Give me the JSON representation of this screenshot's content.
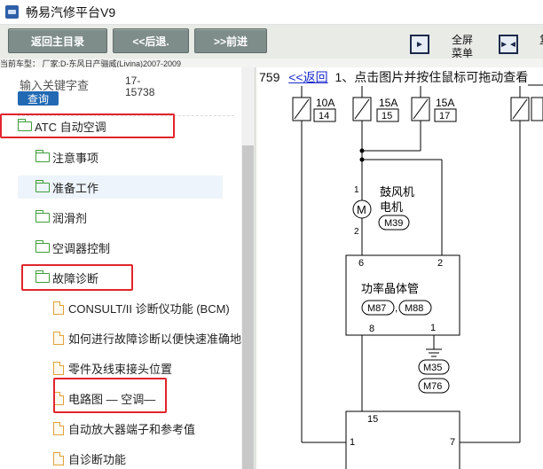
{
  "window": {
    "title": "畅易汽修平台V9"
  },
  "toolbar": {
    "home_label": "返回主目录",
    "back_label": "<<后退.",
    "forward_label": ">>前进",
    "fullscreen_label": "全屏",
    "menu_label": "菜单",
    "cut_label": "复"
  },
  "car_model": "当前车型： 厂家:D-东风日产骊威(Livina)2007-2009",
  "search": {
    "label": "输入关键字查",
    "button": "查询",
    "value": "17-15738"
  },
  "tree": [
    {
      "label": "ATC 自动空调",
      "level": 0,
      "type": "folder",
      "highlighted": true
    },
    {
      "label": "注意事项",
      "level": 1,
      "type": "folder"
    },
    {
      "label": "准备工作",
      "level": 1,
      "type": "folder",
      "selected": true
    },
    {
      "label": "润滑剂",
      "level": 1,
      "type": "folder"
    },
    {
      "label": "空调器控制",
      "level": 1,
      "type": "folder"
    },
    {
      "label": "故障诊断",
      "level": 1,
      "type": "folder",
      "highlighted": true
    },
    {
      "label": "CONSULT/II 诊断仪功能 (BCM)",
      "level": 2,
      "type": "doc"
    },
    {
      "label": "如何进行故障诊断以便快速准确地",
      "level": 2,
      "type": "doc"
    },
    {
      "label": "零件及线束接头位置",
      "level": 2,
      "type": "doc"
    },
    {
      "label": "电路图 — 空调—",
      "level": 2,
      "type": "doc",
      "highlighted": true
    },
    {
      "label": "自动放大器端子和参考值",
      "level": 2,
      "type": "doc"
    },
    {
      "label": "自诊断功能",
      "level": 2,
      "type": "doc"
    }
  ],
  "content": {
    "page_number": "759",
    "back_link": "<<返回",
    "instruction": "1、点击图片并按住鼠标可拖动查看",
    "fuses": [
      {
        "amps": "10A",
        "number": "14"
      },
      {
        "amps": "15A",
        "number": "15"
      },
      {
        "amps": "15A",
        "number": "17"
      }
    ],
    "blower_motor": {
      "label_line1": "鼓风机",
      "label_line2": "电机",
      "connector": "M39",
      "pin_top": "1",
      "pin_bottom": "2"
    },
    "power_transistor": {
      "label": "功率晶体管",
      "connector_a": "M87",
      "connector_b": "M88",
      "pin_6": "6",
      "pin_2": "2",
      "pin_8": "8",
      "pin_1": "1"
    },
    "ground_connectors": [
      "M35",
      "M76"
    ],
    "amplifier": {
      "pin_15": "15",
      "pin_1": "1",
      "pin_7": "7"
    }
  },
  "colors": {
    "toolbar_button": "#7e8d8a",
    "query_button": "#2169b3",
    "highlight": "#e0252b",
    "folder": "#3f9d3a",
    "doc": "#e0a23a",
    "link": "#1a2acc"
  }
}
